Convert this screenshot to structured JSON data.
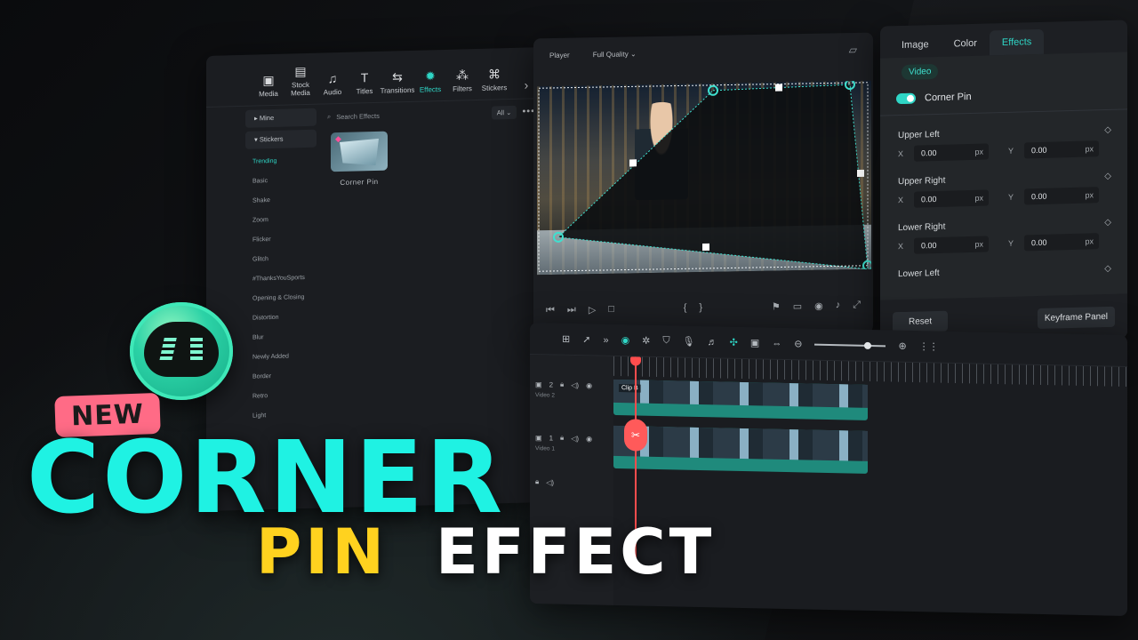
{
  "left_panel": {
    "tabs": [
      {
        "label": "Media",
        "icon": "media-icon",
        "glyph": "▣",
        "active": false
      },
      {
        "label": "Stock Media",
        "icon": "stock-media-icon",
        "glyph": "▤",
        "active": false
      },
      {
        "label": "Audio",
        "icon": "music-note-icon",
        "glyph": "♫",
        "active": false
      },
      {
        "label": "Titles",
        "icon": "text-icon",
        "glyph": "T",
        "active": false
      },
      {
        "label": "Transitions",
        "icon": "transition-icon",
        "glyph": "⇆",
        "active": false
      },
      {
        "label": "Effects",
        "icon": "effects-icon",
        "glyph": "✹",
        "active": true
      },
      {
        "label": "Filters",
        "icon": "filters-icon",
        "glyph": "⁂",
        "active": false
      },
      {
        "label": "Stickers",
        "icon": "stickers-icon",
        "glyph": "⌘",
        "active": false
      }
    ],
    "sidebar": {
      "mine": "Mine",
      "stickers": "Stickers",
      "items": [
        "Trending",
        "Basic",
        "Shake",
        "Zoom",
        "Flicker",
        "Glitch",
        "#ThanksYouSports",
        "Opening & Closing",
        "Distortion",
        "Blur",
        "Newly Added",
        "Border",
        "Retro",
        "Light"
      ],
      "active_item": "Trending"
    },
    "search_placeholder": "Search Effects",
    "filter_value": "All",
    "effect_card_label": "Corner Pin"
  },
  "player": {
    "label": "Player",
    "quality": "Full Quality"
  },
  "properties": {
    "tabs": [
      "Image",
      "Color",
      "Effects"
    ],
    "active_tab": "Effects",
    "section_chip": "Video",
    "toggle_label": "Corner Pin",
    "corners": [
      {
        "title": "Upper Left",
        "x": "0.00",
        "y": "0.00"
      },
      {
        "title": "Upper Right",
        "x": "0.00",
        "y": "0.00"
      },
      {
        "title": "Lower Right",
        "x": "0.00",
        "y": "0.00"
      },
      {
        "title": "Lower Left",
        "x": "",
        "y": ""
      }
    ],
    "x_label": "X",
    "y_label": "Y",
    "unit": "px",
    "reset_label": "Reset",
    "keyframe_label": "Keyframe Panel"
  },
  "timeline": {
    "track2_num": "2",
    "track2_name": "Video 2",
    "track1_num": "1",
    "track1_name": "Video 1",
    "clip_b_label": "Clip B"
  },
  "title": {
    "badge": "NEW",
    "line1": "CORNER",
    "line2a": "PIN",
    "line2b": "EFFECT"
  },
  "colors": {
    "accent": "#2fd6c6",
    "title_cyan": "#1ff2e3",
    "title_yellow": "#ffd21f",
    "badge_pink": "#ff6b86",
    "playhead_red": "#ff4d4d"
  }
}
